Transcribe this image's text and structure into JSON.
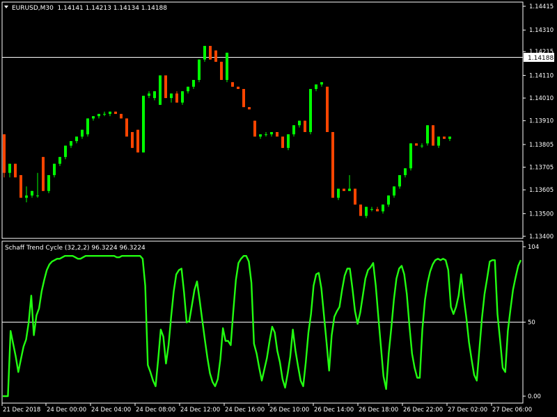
{
  "header": {
    "symbol_line": "EURUSD,M30  1.14141 1.14213 1.14134 1.14188",
    "dropdown_icon": "triangle-down-icon"
  },
  "indicator": {
    "title": "Schaff Trend Cycle (32,2,2) 96.3224 96.3224"
  },
  "colors": {
    "background": "#000000",
    "bull": "#00ff00",
    "bear": "#ff4500",
    "stc_line": "#22ff11",
    "axis": "#ffffff",
    "grid_line": "#ffffff"
  },
  "chart_data": [
    {
      "type": "candlestick",
      "title": "EURUSD,M30",
      "current_price": 1.14188,
      "current_price_label": "1.14188",
      "ylim": [
        1.134,
        1.1445
      ],
      "y_tick_labels": [
        "1.14415",
        "1.14310",
        "1.14215",
        "1.14110",
        "1.14010",
        "1.13910",
        "1.13805",
        "1.13705",
        "1.13605",
        "1.13500",
        "1.13400"
      ],
      "x_tick_labels": [
        "21 Dec 2018",
        "24 Dec 00:00",
        "24 Dec 04:00",
        "24 Dec 08:00",
        "24 Dec 12:00",
        "24 Dec 16:00",
        "26 Dec 10:00",
        "26 Dec 14:00",
        "26 Dec 18:00",
        "26 Dec 22:00",
        "27 Dec 02:00",
        "27 Dec 06:00"
      ],
      "candles": [
        [
          1.1385,
          1.1385,
          1.1366,
          1.1368
        ],
        [
          1.1368,
          1.1372,
          1.1366,
          1.1372
        ],
        [
          1.1372,
          1.1372,
          1.1366,
          1.1366
        ],
        [
          1.1367,
          1.1367,
          1.1357,
          1.1357
        ],
        [
          1.1357,
          1.1362,
          1.1355,
          1.1358
        ],
        [
          1.1358,
          1.136,
          1.1357,
          1.136
        ],
        [
          1.1358,
          1.1368,
          1.1357,
          1.1358
        ],
        [
          1.1375,
          1.1375,
          1.136,
          1.136
        ],
        [
          1.136,
          1.1367,
          1.1359,
          1.1367
        ],
        [
          1.1367,
          1.1372,
          1.1366,
          1.1372
        ],
        [
          1.1372,
          1.1375,
          1.1371,
          1.1375
        ],
        [
          1.1375,
          1.138,
          1.1374,
          1.138
        ],
        [
          1.138,
          1.1382,
          1.1379,
          1.1382
        ],
        [
          1.1382,
          1.1384,
          1.1381,
          1.1384
        ],
        [
          1.1384,
          1.1387,
          1.1383,
          1.1387
        ],
        [
          1.1385,
          1.1392,
          1.1384,
          1.1392
        ],
        [
          1.1392,
          1.1393,
          1.1391,
          1.1393
        ],
        [
          1.1393,
          1.1394,
          1.1392,
          1.1394
        ],
        [
          1.1394,
          1.1395,
          1.1393,
          1.1394
        ],
        [
          1.1394,
          1.1395,
          1.1393,
          1.1395
        ],
        [
          1.1395,
          1.1395,
          1.1394,
          1.1394
        ],
        [
          1.1394,
          1.1394,
          1.1392,
          1.1392
        ],
        [
          1.1392,
          1.1392,
          1.1384,
          1.1384
        ],
        [
          1.1386,
          1.1386,
          1.1379,
          1.1379
        ],
        [
          1.1387,
          1.1387,
          1.1377,
          1.1377
        ],
        [
          1.1377,
          1.1402,
          1.1377,
          1.1402
        ],
        [
          1.1402,
          1.1404,
          1.1401,
          1.1403
        ],
        [
          1.1401,
          1.1404,
          1.14,
          1.1404
        ],
        [
          1.1398,
          1.1411,
          1.1398,
          1.1411
        ],
        [
          1.1411,
          1.1411,
          1.1401,
          1.1401
        ],
        [
          1.1401,
          1.1403,
          1.1399,
          1.1403
        ],
        [
          1.1403,
          1.1404,
          1.1399,
          1.1399
        ],
        [
          1.1399,
          1.1404,
          1.1398,
          1.1404
        ],
        [
          1.1404,
          1.1406,
          1.1403,
          1.1406
        ],
        [
          1.1406,
          1.1409,
          1.1405,
          1.1409
        ],
        [
          1.1409,
          1.1418,
          1.1408,
          1.1418
        ],
        [
          1.1418,
          1.1424,
          1.1417,
          1.1424
        ],
        [
          1.1424,
          1.1424,
          1.1418,
          1.1418
        ],
        [
          1.1422,
          1.1422,
          1.1417,
          1.1417
        ],
        [
          1.1417,
          1.1417,
          1.1409,
          1.1409
        ],
        [
          1.1409,
          1.1421,
          1.1408,
          1.1421
        ],
        [
          1.1408,
          1.1408,
          1.1406,
          1.1406
        ],
        [
          1.1406,
          1.1406,
          1.1405,
          1.1405
        ],
        [
          1.1405,
          1.1405,
          1.1397,
          1.1397
        ],
        [
          1.1397,
          1.1397,
          1.1396,
          1.1396
        ],
        [
          1.1391,
          1.1391,
          1.1384,
          1.1384
        ],
        [
          1.1384,
          1.1385,
          1.1383,
          1.1385
        ],
        [
          1.1385,
          1.1386,
          1.1384,
          1.1385
        ],
        [
          1.1385,
          1.1386,
          1.1384,
          1.1386
        ],
        [
          1.1386,
          1.1386,
          1.1384,
          1.1384
        ],
        [
          1.1384,
          1.1384,
          1.1379,
          1.1379
        ],
        [
          1.1379,
          1.1385,
          1.1378,
          1.1385
        ],
        [
          1.1385,
          1.1389,
          1.1384,
          1.1389
        ],
        [
          1.1389,
          1.1391,
          1.1388,
          1.1391
        ],
        [
          1.1391,
          1.1391,
          1.1386,
          1.1386
        ],
        [
          1.1386,
          1.1405,
          1.1385,
          1.1405
        ],
        [
          1.1405,
          1.1407,
          1.1404,
          1.1407
        ],
        [
          1.1407,
          1.1408,
          1.1406,
          1.1408
        ],
        [
          1.1406,
          1.1406,
          1.1386,
          1.1386
        ],
        [
          1.1386,
          1.1386,
          1.1357,
          1.1357
        ],
        [
          1.1357,
          1.1361,
          1.1356,
          1.1361
        ],
        [
          1.1361,
          1.1361,
          1.136,
          1.136
        ],
        [
          1.136,
          1.1367,
          1.136,
          1.1361
        ],
        [
          1.1361,
          1.1361,
          1.1354,
          1.1354
        ],
        [
          1.1354,
          1.1354,
          1.1349,
          1.1349
        ],
        [
          1.1349,
          1.1353,
          1.1348,
          1.1353
        ],
        [
          1.1352,
          1.1353,
          1.1351,
          1.1352
        ],
        [
          1.1352,
          1.1353,
          1.1351,
          1.1351
        ],
        [
          1.1351,
          1.1354,
          1.135,
          1.1354
        ],
        [
          1.1354,
          1.1358,
          1.1353,
          1.1358
        ],
        [
          1.1358,
          1.1362,
          1.1357,
          1.1362
        ],
        [
          1.1362,
          1.1367,
          1.1361,
          1.1367
        ],
        [
          1.1367,
          1.137,
          1.1366,
          1.137
        ],
        [
          1.137,
          1.1381,
          1.1369,
          1.1381
        ],
        [
          1.1381,
          1.1381,
          1.138,
          1.138
        ],
        [
          1.138,
          1.1381,
          1.1379,
          1.138
        ],
        [
          1.1381,
          1.1389,
          1.138,
          1.1389
        ],
        [
          1.1389,
          1.1389,
          1.138,
          1.138
        ],
        [
          1.138,
          1.1384,
          1.1379,
          1.1384
        ],
        [
          1.1384,
          1.1384,
          1.1383,
          1.1383
        ],
        [
          1.1383,
          1.1384,
          1.1382,
          1.1384
        ]
      ]
    },
    {
      "type": "line",
      "title": "Schaff Trend Cycle (32,2,2)",
      "ylim": [
        0,
        104
      ],
      "y_tick_labels": [
        "104",
        "50",
        "0.00"
      ],
      "reference_level": 50,
      "values": [
        0,
        0,
        0,
        46,
        37,
        28,
        17,
        26,
        35,
        40,
        52,
        71,
        43,
        57,
        62,
        74,
        82,
        89,
        93,
        95,
        96,
        97,
        97,
        98,
        99,
        99,
        99,
        99,
        98,
        97,
        97,
        98,
        99,
        99,
        99,
        99,
        99,
        99,
        99,
        99,
        99,
        99,
        99,
        99,
        98,
        98,
        99,
        99,
        99,
        99,
        99,
        99,
        99,
        99,
        97,
        78,
        22,
        17,
        11,
        7,
        26,
        47,
        42,
        23,
        36,
        56,
        74,
        86,
        89,
        90,
        73,
        52,
        53,
        64,
        75,
        81,
        68,
        54,
        40,
        27,
        16,
        10,
        7,
        12,
        26,
        48,
        39,
        39,
        36,
        60,
        82,
        94,
        97,
        99,
        99,
        95,
        80,
        37,
        30,
        20,
        11,
        19,
        27,
        39,
        49,
        45,
        32,
        24,
        12,
        6,
        16,
        28,
        47,
        32,
        21,
        11,
        7,
        24,
        45,
        58,
        78,
        86,
        87,
        76,
        57,
        38,
        18,
        43,
        56,
        60,
        63,
        75,
        85,
        90,
        90,
        76,
        60,
        51,
        59,
        71,
        83,
        89,
        91,
        94,
        78,
        56,
        35,
        14,
        5,
        30,
        48,
        68,
        83,
        90,
        92,
        86,
        72,
        50,
        30,
        20,
        13,
        13,
        47,
        68,
        80,
        88,
        93,
        96,
        97,
        96,
        97,
        96,
        89,
        63,
        58,
        63,
        71,
        86,
        69,
        55,
        38,
        26,
        15,
        11,
        33,
        55,
        72,
        83,
        95,
        96,
        96,
        58,
        40,
        20,
        17,
        46,
        61,
        75,
        84,
        92,
        96
      ]
    }
  ]
}
